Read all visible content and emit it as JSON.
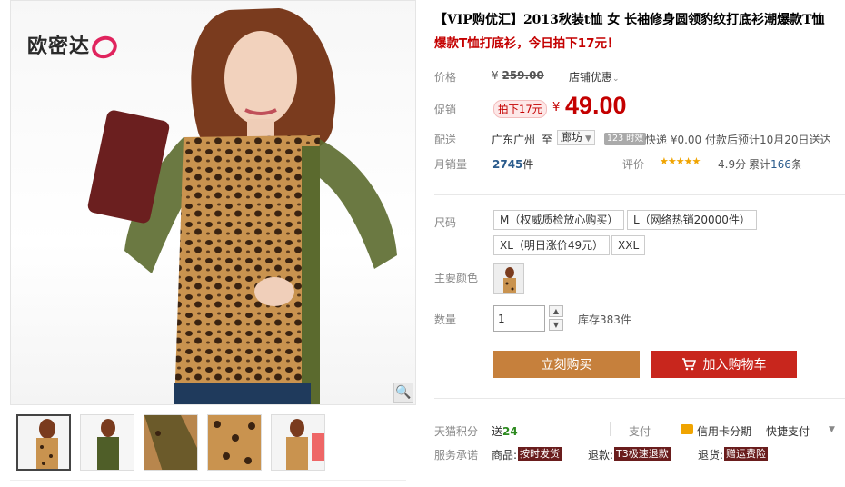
{
  "gallery": {
    "brand_text": "欧密达",
    "zoom_icon": "magnifier-icon",
    "thumbnails": [
      {
        "alt": "thumb-1"
      },
      {
        "alt": "thumb-2"
      },
      {
        "alt": "thumb-3"
      },
      {
        "alt": "thumb-4"
      },
      {
        "alt": "thumb-5"
      }
    ]
  },
  "product": {
    "title": "【VIP购优汇】2013秋装t恤 女 长袖修身圆领豹纹打底衫潮爆款T恤",
    "subtitle": "爆款T恤打底衫，今日拍下17元！"
  },
  "price": {
    "label": "价格",
    "currency": "¥",
    "original": "259.00",
    "shop_discount": "店铺优惠"
  },
  "promo": {
    "label": "促销",
    "tag": "拍下17元",
    "currency": "¥",
    "price": "49.00"
  },
  "shipping": {
    "label": "配送",
    "from": "广东广州",
    "to_word": "至",
    "city": "廊坊",
    "time_badge": "123 时效",
    "info": "快递 ¥0.00 付款后预计10月20日送达"
  },
  "sales": {
    "label": "月销量",
    "count": "2745",
    "unit": "件",
    "rating_label": "评价",
    "stars": "★★★★★",
    "score": "4.9分",
    "reviews_prefix": "累计",
    "reviews_count": "166",
    "reviews_suffix": "条"
  },
  "size": {
    "label": "尺码",
    "options": [
      "M（权威质检放心购买）",
      "L（网络热销20000件）",
      "XL（明日涨价49元）",
      "XXL"
    ]
  },
  "color": {
    "label": "主要颜色"
  },
  "quantity": {
    "label": "数量",
    "value": "1",
    "stock": "库存383件"
  },
  "actions": {
    "buy_now": "立刻购买",
    "add_cart": "加入购物车"
  },
  "points": {
    "label": "天猫积分",
    "prefix": "送",
    "value": "24"
  },
  "payment": {
    "label": "支付",
    "credit": "信用卡分期",
    "quick": "快捷支付"
  },
  "service": {
    "label": "服务承诺",
    "goods_label": "商品:",
    "goods_tag": "按时发货",
    "refund_label": "退款:",
    "refund_tag": "T3极速退款",
    "return_label": "退货:",
    "return_tag": "赠运费险"
  },
  "colors": {
    "accent_red": "#c40000",
    "buy_button": "#c6803c",
    "cart_button": "#c8261d"
  }
}
